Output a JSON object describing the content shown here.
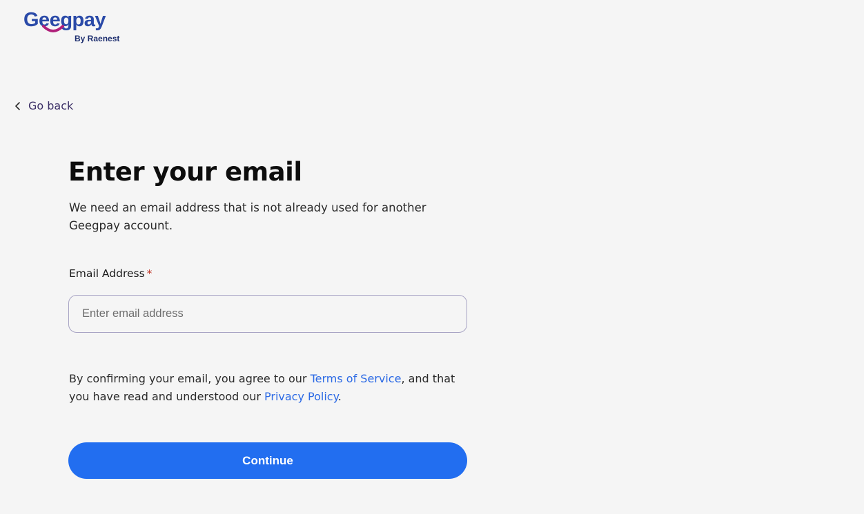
{
  "brand": {
    "name": "Geegpay",
    "tagline": "By Raenest",
    "colors": {
      "primary": "#2a4aa8",
      "smile": "#b0207a",
      "sub": "#1c2d6e"
    }
  },
  "nav": {
    "back_label": "Go back",
    "back_icon": "chevron-left-icon"
  },
  "form": {
    "title": "Enter your email",
    "subtitle": "We need an email address that is not already used for another Geegpay account.",
    "email": {
      "label": "Email Address",
      "required_mark": "*",
      "placeholder": "Enter email address",
      "value": ""
    },
    "legal": {
      "part1": "By confirming your email, you agree to our ",
      "terms_link": "Terms of Service",
      "part2": ", and that you have read and understood our ",
      "privacy_link": "Privacy Policy",
      "part3": "."
    },
    "continue_label": "Continue"
  },
  "colors": {
    "background": "#f5f5f5",
    "accent": "#226ef0",
    "link": "#2c6ae5",
    "required": "#c0392b"
  }
}
